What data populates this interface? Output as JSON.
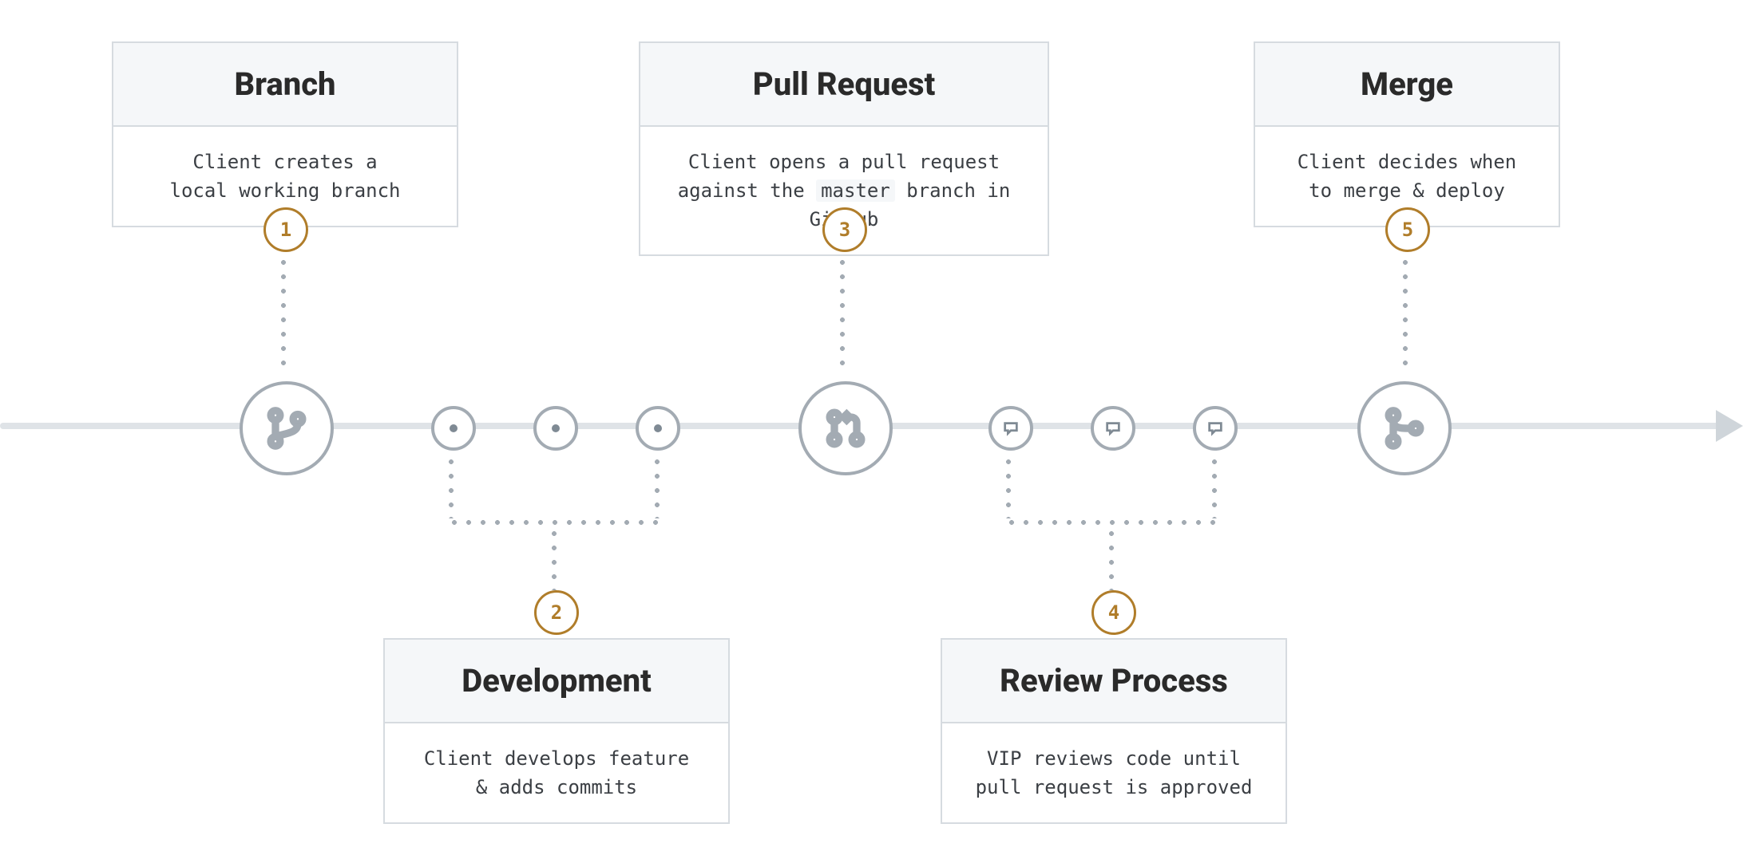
{
  "steps": [
    {
      "num": "1",
      "title": "Branch",
      "desc_line1": "Client creates a",
      "desc_line2": "local working branch",
      "has_code": false
    },
    {
      "num": "2",
      "title": "Development",
      "desc_line1": "Client develops feature",
      "desc_line2": "& adds commits",
      "has_code": false
    },
    {
      "num": "3",
      "title": "Pull Request",
      "desc_line1": "Client opens a pull request",
      "desc_prefix": "against the ",
      "code": "master",
      "desc_suffix": " branch in GitHub",
      "has_code": true
    },
    {
      "num": "4",
      "title": "Review Process",
      "desc_line1": "VIP reviews code until",
      "desc_line2": "pull request is approved",
      "has_code": false
    },
    {
      "num": "5",
      "title": "Merge",
      "desc_line1": "Client decides when",
      "desc_line2": "to merge & deploy",
      "has_code": false
    }
  ],
  "icons": {
    "branch": "git-branch-icon",
    "commit": "commit-dot-icon",
    "pull_request": "pull-request-icon",
    "review": "comment-icon",
    "merge": "git-merge-icon"
  },
  "colors": {
    "accent": "#b07d2a",
    "muted": "#a3abb3",
    "line": "#dfe3e7",
    "card_head_bg": "#f5f7f9",
    "card_border": "#d6dbe0"
  }
}
